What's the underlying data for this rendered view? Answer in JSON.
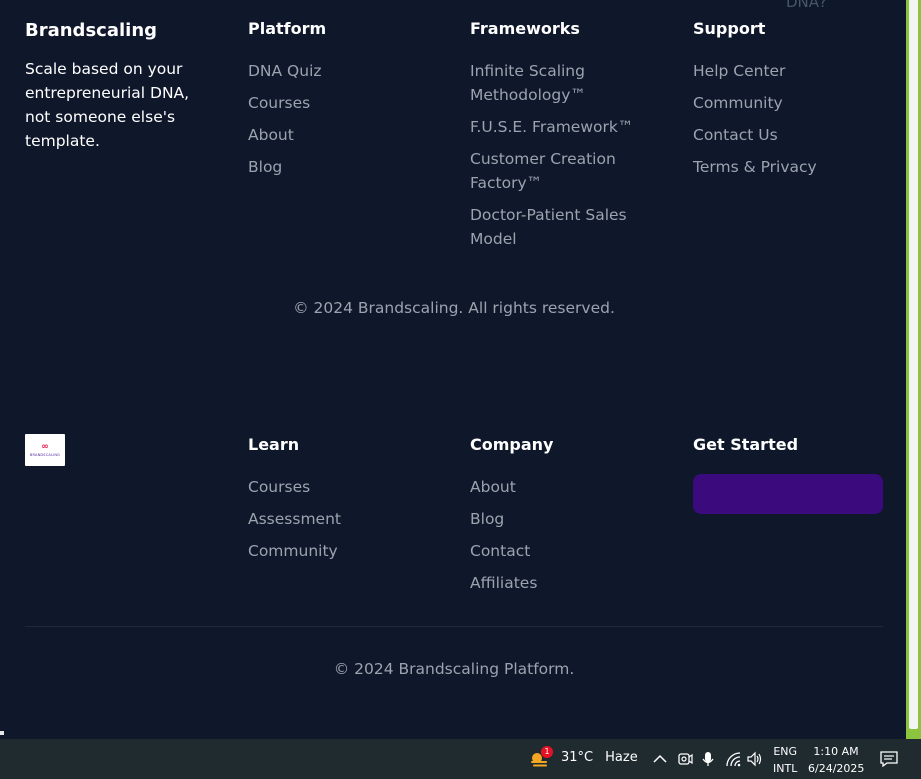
{
  "ghost_text": "DNA?",
  "footer_top": {
    "brand": {
      "name": "Brandscaling",
      "tagline": "Scale based on your entrepreneurial DNA, not someone else's template."
    },
    "columns": [
      {
        "title": "Platform",
        "links": [
          "DNA Quiz",
          "Courses",
          "About",
          "Blog"
        ]
      },
      {
        "title": "Frameworks",
        "links": [
          "Infinite Scaling Methodology™",
          "F.U.S.E. Framework™",
          "Customer Creation Factory™",
          "Doctor-Patient Sales Model"
        ]
      },
      {
        "title": "Support",
        "links": [
          "Help Center",
          "Community",
          "Contact Us",
          "Terms & Privacy"
        ]
      }
    ],
    "copyright": "© 2024 Brandscaling. All rights reserved."
  },
  "footer_bottom": {
    "logo": {
      "mark": "∞",
      "text": "BRANDSCALING"
    },
    "columns": [
      {
        "title": "Learn",
        "links": [
          "Courses",
          "Assessment",
          "Community"
        ]
      },
      {
        "title": "Company",
        "links": [
          "About",
          "Blog",
          "Contact",
          "Affiliates"
        ]
      }
    ],
    "get_started": {
      "title": "Get Started",
      "button_label": ""
    },
    "copyright": "© 2024 Brandscaling Platform."
  },
  "taskbar": {
    "weather_badge": "1",
    "temperature": "31°C",
    "condition": "Haze",
    "lang_line1": "ENG",
    "lang_line2": "INTL",
    "time": "1:10 AM",
    "date": "6/24/2025",
    "icons": [
      "weather-icon",
      "chevron-up-icon",
      "camera-icon",
      "microphone-icon",
      "wifi-icon",
      "speaker-icon",
      "notification-icon"
    ]
  },
  "colors": {
    "background": "#0f172a",
    "link": "#9ca3af",
    "heading": "#ffffff",
    "cta": "#3b0b7d",
    "accent_scrollbar": "#8bc53f",
    "taskbar": "#1f2b2f"
  }
}
